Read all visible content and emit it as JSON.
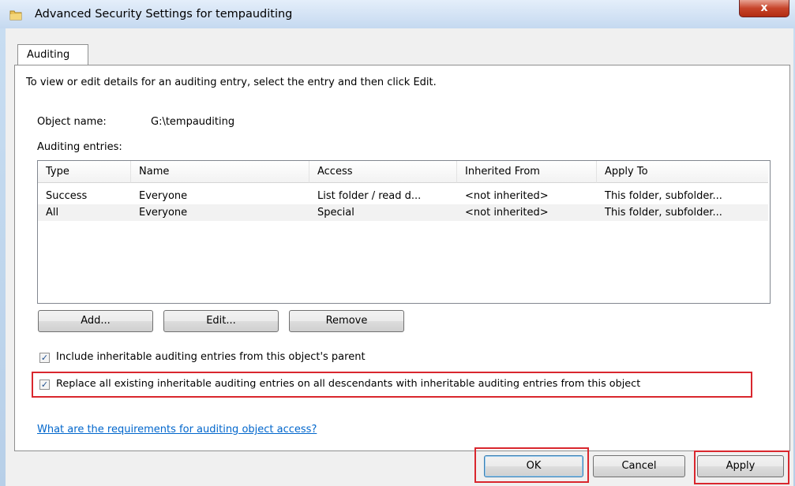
{
  "window": {
    "title": "Advanced Security Settings for tempauditing",
    "close_label": "x"
  },
  "tabs": [
    {
      "label": "Auditing"
    }
  ],
  "instructions": "To view or edit details for an auditing entry, select the entry and then click Edit.",
  "object": {
    "label": "Object name:",
    "value": "G:\\tempauditing"
  },
  "entries": {
    "label": "Auditing entries:",
    "columns": [
      "Type",
      "Name",
      "Access",
      "Inherited From",
      "Apply To"
    ],
    "rows": [
      [
        "Success",
        "Everyone",
        "List folder / read d...",
        "<not inherited>",
        "This folder, subfolder..."
      ],
      [
        "All",
        "Everyone",
        "Special",
        "<not inherited>",
        "This folder, subfolder..."
      ]
    ]
  },
  "actions": {
    "add": "Add...",
    "edit": "Edit...",
    "remove": "Remove"
  },
  "checkboxes": {
    "include": {
      "label": "Include inheritable auditing entries from this object's parent",
      "checked": true
    },
    "replace": {
      "label": "Replace all existing inheritable auditing entries on all descendants with inheritable auditing entries from this object",
      "checked": true
    }
  },
  "help_link": "What are the requirements for auditing object access?",
  "footer": {
    "ok": "OK",
    "cancel": "Cancel",
    "apply": "Apply"
  },
  "colors": {
    "highlight_box": "#d9272e",
    "link": "#0066cc"
  }
}
